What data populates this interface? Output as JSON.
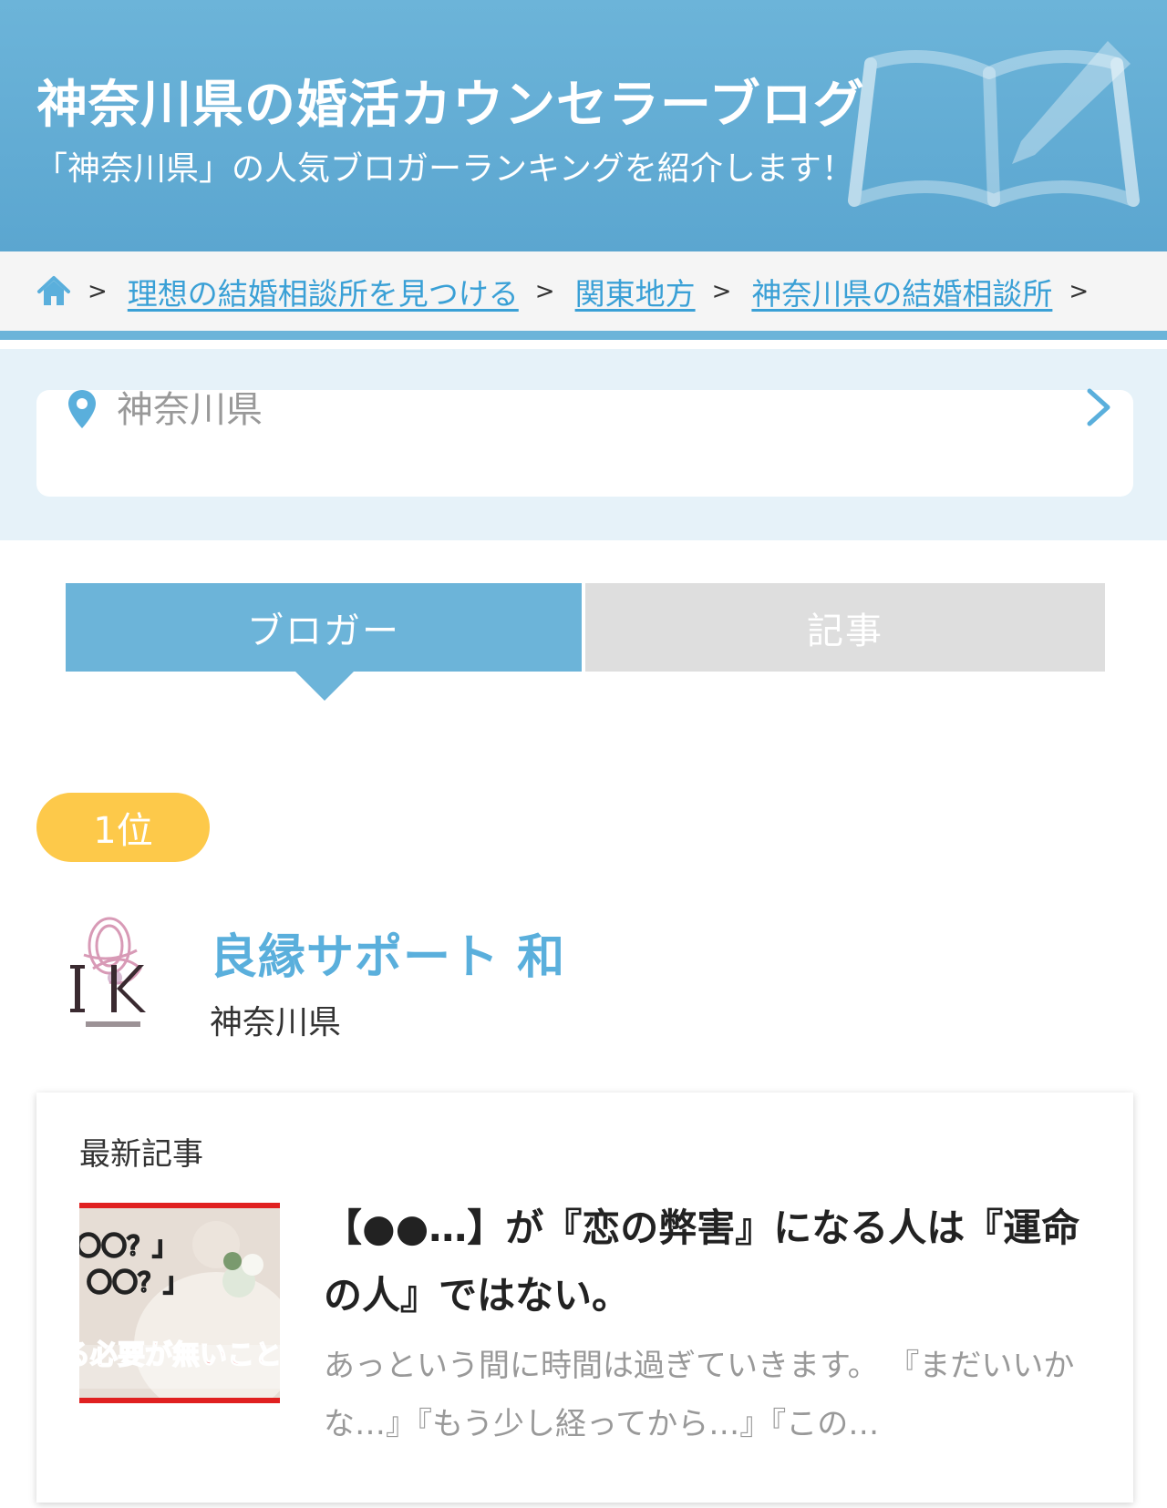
{
  "header": {
    "title": "神奈川県の婚活カウンセラーブログ",
    "subtitle": "「神奈川県」の人気ブロガーランキングを紹介します！"
  },
  "breadcrumb": {
    "items": [
      "理想の結婚相談所を見つける",
      "関東地方",
      "神奈川県の結婚相談所"
    ],
    "separator": ">"
  },
  "location": {
    "value": "神奈川県"
  },
  "tabs": [
    {
      "label": "ブロガー",
      "active": true
    },
    {
      "label": "記事",
      "active": false
    }
  ],
  "ranking": {
    "rank_label": "1位",
    "agency_name": "良縁サポート 和",
    "agency_location": "神奈川県",
    "latest": {
      "section_label": "最新記事",
      "title": "【●●…】が『恋の弊害』になる人は『運命の人』ではない。",
      "excerpt": "あっという間に時間は過ぎていきます。 『まだいいかな…』『もう少し経ってから…』『この…",
      "thumbnail_text": [
        "〇〇？」",
        "〇〇？」",
        "る必要が無いこと"
      ]
    }
  },
  "colors": {
    "accent": "#6cb4d9",
    "link": "#3aa0d6",
    "badge": "#fdc94a",
    "tab_inactive": "#dedede"
  }
}
